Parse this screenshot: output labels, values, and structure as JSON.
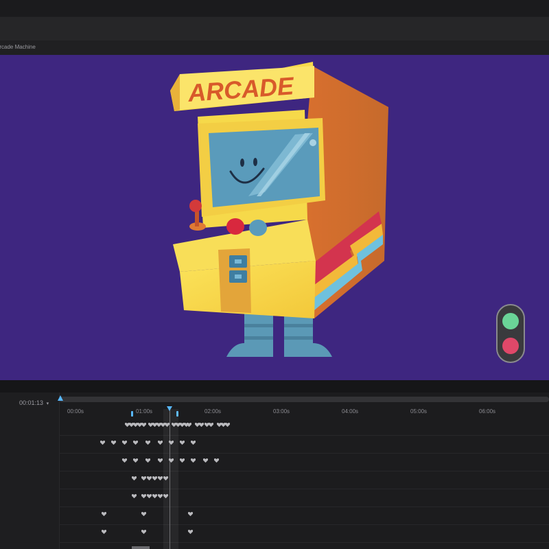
{
  "document": {
    "tab_label": "Arcade Machine"
  },
  "artwork": {
    "marquee_text": "ARCADE"
  },
  "colors": {
    "stage": "#3e2680",
    "accent": "#58b8ff",
    "cabinet_yellow": "#f6d94a",
    "cabinet_orange": "#e2873a",
    "screen": "#5a9bbb"
  },
  "icons": {
    "keyframe": "keyframe-heart-icon",
    "traffic_light": "traffic-light-icon"
  },
  "timeline": {
    "current_time": "00:01:13",
    "timecode_caret": "▾",
    "ruler": [
      "00:00s",
      "01:00s",
      "02:00s",
      "03:00s",
      "04:00s",
      "05:00s",
      "06:00s"
    ]
  }
}
